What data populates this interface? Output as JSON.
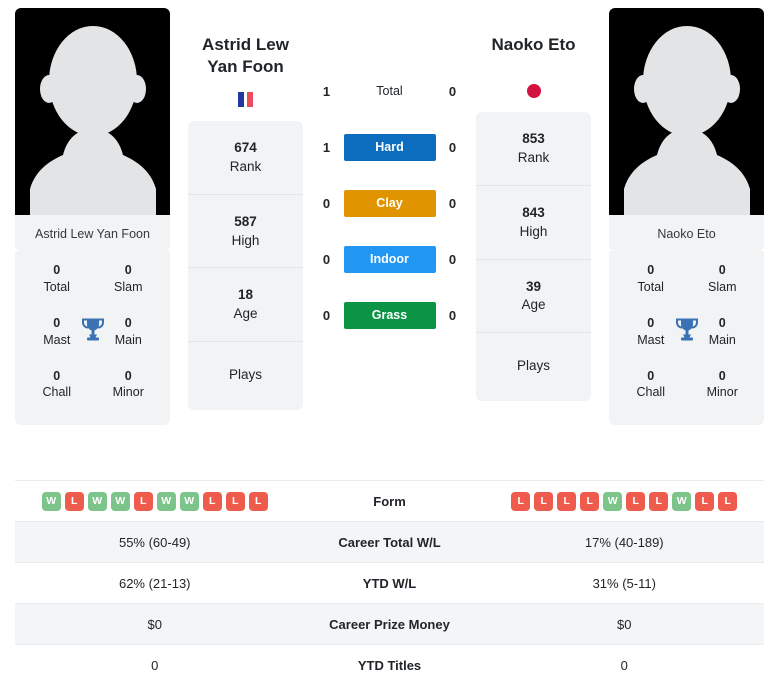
{
  "players": {
    "left": {
      "name": "Astrid Lew Yan Foon",
      "name_display": "Astrid Lew Yan Foon",
      "photo_caption": "Astrid Lew Yan Foon",
      "country_flag": "flag-france-icon",
      "rank": "674",
      "rank_label": "Rank",
      "high": "587",
      "high_label": "High",
      "age": "18",
      "age_label": "Age",
      "plays_label": "Plays",
      "plays_value": "",
      "titles": {
        "total": "0",
        "total_label": "Total",
        "slam": "0",
        "slam_label": "Slam",
        "mast": "0",
        "mast_label": "Mast",
        "main": "0",
        "main_label": "Main",
        "chall": "0",
        "chall_label": "Chall",
        "minor": "0",
        "minor_label": "Minor"
      },
      "form": [
        "W",
        "L",
        "W",
        "W",
        "L",
        "W",
        "W",
        "L",
        "L",
        "L"
      ],
      "career_total_wl": "55% (60-49)",
      "ytd_wl": "62% (21-13)",
      "career_prize_money": "$0",
      "ytd_titles": "0"
    },
    "right": {
      "name": "Naoko Eto",
      "name_display": "Naoko Eto",
      "photo_caption": "Naoko Eto",
      "country_flag": "flag-japan-icon",
      "rank": "853",
      "rank_label": "Rank",
      "high": "843",
      "high_label": "High",
      "age": "39",
      "age_label": "Age",
      "plays_label": "Plays",
      "plays_value": "",
      "titles": {
        "total": "0",
        "total_label": "Total",
        "slam": "0",
        "slam_label": "Slam",
        "mast": "0",
        "mast_label": "Mast",
        "main": "0",
        "main_label": "Main",
        "chall": "0",
        "chall_label": "Chall",
        "minor": "0",
        "minor_label": "Minor"
      },
      "form": [
        "L",
        "L",
        "L",
        "L",
        "W",
        "L",
        "L",
        "W",
        "L",
        "L"
      ],
      "career_total_wl": "17% (40-189)",
      "ytd_wl": "31% (5-11)",
      "career_prize_money": "$0",
      "ytd_titles": "0"
    }
  },
  "head_to_head": {
    "rows": [
      {
        "label": "Total",
        "left": "1",
        "right": "0",
        "type": "plain",
        "color": ""
      },
      {
        "label": "Hard",
        "left": "1",
        "right": "0",
        "type": "surface",
        "color": "#0c6cbe"
      },
      {
        "label": "Clay",
        "left": "0",
        "right": "0",
        "type": "surface",
        "color": "#e09400"
      },
      {
        "label": "Indoor",
        "left": "0",
        "right": "0",
        "type": "surface",
        "color": "#2196f3"
      },
      {
        "label": "Grass",
        "left": "0",
        "right": "0",
        "type": "surface",
        "color": "#0b9444"
      }
    ]
  },
  "stats_table": {
    "rows": [
      {
        "label": "Form",
        "kind": "form"
      },
      {
        "label": "Career Total W/L",
        "kind": "text",
        "key": "career_total_wl"
      },
      {
        "label": "YTD W/L",
        "kind": "text",
        "key": "ytd_wl"
      },
      {
        "label": "Career Prize Money",
        "kind": "text",
        "key": "career_prize_money"
      },
      {
        "label": "YTD Titles",
        "kind": "text",
        "key": "ytd_titles"
      }
    ]
  },
  "colors": {
    "hard": "#0c6cbe",
    "clay": "#e09400",
    "indoor": "#2196f3",
    "grass": "#0b9444",
    "win": "#7cc489",
    "loss": "#ef5b4c",
    "panel": "#f1f3f5",
    "trophy": "#3b72b3"
  }
}
